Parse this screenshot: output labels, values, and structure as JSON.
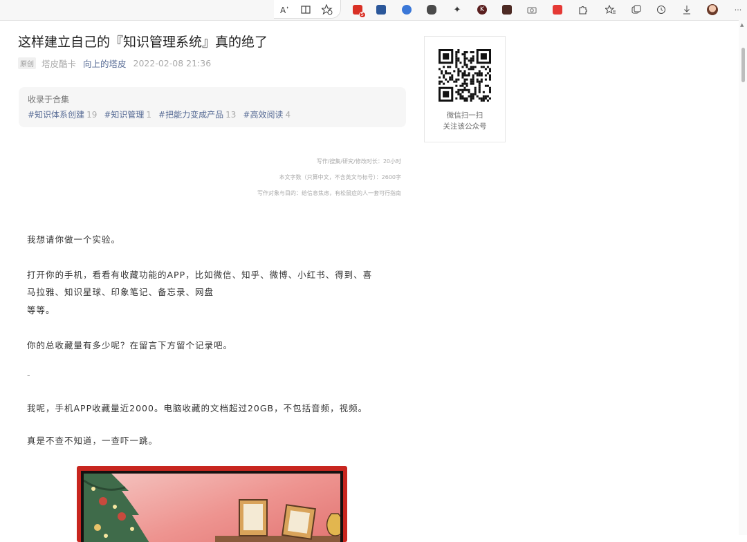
{
  "browser": {
    "toolbar_icons": [
      "read-aloud-icon",
      "immersive-reader-icon",
      "favorite-add-icon",
      "gmail-extension-icon",
      "word-extension-icon",
      "extension-blue-icon",
      "extension-dark-icon",
      "sparkle-extension-icon",
      "k-extension-icon",
      "chart-extension-icon",
      "camera-extension-icon",
      "red-extension-icon",
      "extensions-puzzle-icon",
      "favorites-icon",
      "collections-icon",
      "history-icon",
      "downloads-icon",
      "profile-avatar",
      "more-menu-icon"
    ],
    "gmail_badge": "5",
    "more_label": "···"
  },
  "article": {
    "title": "这样建立自己的『知识管理系统』真的绝了",
    "badge": "原创",
    "author": "塔皮酷卡",
    "account": "向上的塔皮",
    "date": "2022-02-08 21:36"
  },
  "collection": {
    "label": "收录于合集",
    "tags": [
      {
        "name": "#知识体系创建",
        "count": "19"
      },
      {
        "name": "#知识管理",
        "count": "1"
      },
      {
        "name": "#把能力变成产品",
        "count": "13"
      },
      {
        "name": "#高效阅读",
        "count": "4"
      }
    ]
  },
  "notes": [
    "写作/搜集/研究/修改时长：20小时",
    "本文字数（只算中文，不含英文与标号）：2600字",
    "写作对象与目的：给信息焦虑，有松鼠症的人一套可行指南"
  ],
  "paragraphs": [
    "我想请你做一个实验。",
    "打开你的手机，看看有收藏功能的APP，比如微信、知乎、微博、小红书、得到、喜",
    "马拉雅、知识星球、印象笔记、备忘录、网盘",
    "等等。",
    "你的总收藏量有多少呢？在留言下方留个记录吧。",
    "-",
    "我呢，手机APP收藏量近2000。电脑收藏的文档超过20GB，不包括音频，视频。",
    "真是不查不知道，一查吓一跳。"
  ],
  "qr": {
    "line1": "微信扫一扫",
    "line2": "关注该公众号"
  },
  "colors": {
    "link": "#576b95",
    "image_frame": "#c8261f"
  }
}
